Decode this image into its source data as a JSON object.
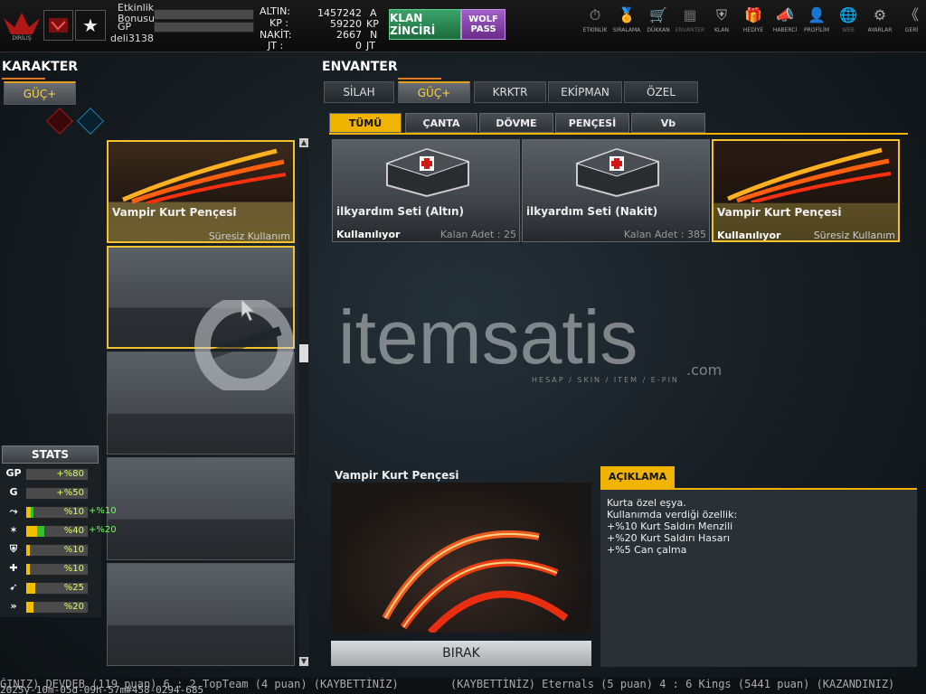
{
  "player": {
    "event_bonus_label": "Etkinlik Bonusu",
    "gp_label": "GP",
    "username": "deli3138"
  },
  "currency": [
    {
      "label": "ALTIN:",
      "value": "1457242",
      "unit": "A"
    },
    {
      "label": "KP :",
      "value": "59220",
      "unit": "KP"
    },
    {
      "label": "NAKİT:",
      "value": "2667",
      "unit": "N"
    },
    {
      "label": "JT :",
      "value": "0",
      "unit": "JT"
    }
  ],
  "buttons": {
    "klan": "KLAN ZİNCİRİ",
    "wolf": "WOLF PASS",
    "drop": "BIRAK"
  },
  "nav": [
    {
      "label": "ETKİNLİK",
      "icon": "stopwatch-icon",
      "glyph": "⏱"
    },
    {
      "label": "SIRALAMA",
      "icon": "medal-icon",
      "glyph": "🏅"
    },
    {
      "label": "DÜKKAN",
      "icon": "cart-icon",
      "glyph": "🛒"
    },
    {
      "label": "ENVANTER",
      "icon": "inventory-icon",
      "glyph": "▦"
    },
    {
      "label": "KLAN",
      "icon": "shield-icon",
      "glyph": "⛨"
    },
    {
      "label": "HEDİYE",
      "icon": "gift-icon",
      "glyph": "🎁"
    },
    {
      "label": "HABERCİ",
      "icon": "megaphone-icon",
      "glyph": "📣"
    },
    {
      "label": "PROFİLİM",
      "icon": "profile-icon",
      "glyph": "👤"
    },
    {
      "label": "WEB",
      "icon": "globe-icon",
      "glyph": "🌐"
    },
    {
      "label": "AYARLAR",
      "icon": "gear-icon",
      "glyph": "⚙"
    },
    {
      "label": "GERİ",
      "icon": "back-icon",
      "glyph": "《"
    }
  ],
  "character": {
    "title": "KARAKTER",
    "tab": "GÜÇ+"
  },
  "inventory": {
    "title": "ENVANTER",
    "tabs": [
      "SİLAH",
      "GÜÇ+",
      "KRKTR",
      "EKİPMAN",
      "ÖZEL"
    ],
    "subtabs": [
      "TÜMÜ",
      "ÇANTA",
      "DÖVME",
      "PENÇESİ",
      "Vb"
    ]
  },
  "slots": [
    {
      "name": "Vampir Kurt Pençesi",
      "duration": "Süresiz Kullanım"
    }
  ],
  "items": [
    {
      "name": "ilkyardım Seti (Altın)",
      "status": "Kullanılıyor",
      "info": "Kalan Adet : 25"
    },
    {
      "name": "ilkyardım Seti (Nakit)",
      "status": "",
      "info": "Kalan Adet : 385"
    },
    {
      "name": "Vampir Kurt Pençesi",
      "status": "Kullanılıyor",
      "info": "Süresiz Kullanım"
    }
  ],
  "stats": {
    "title": "STATS",
    "rows": [
      {
        "icon": "gp-icon",
        "glyph": "GP",
        "value": "+%80",
        "bonus": "",
        "fill": 0
      },
      {
        "icon": "g-icon",
        "glyph": "G",
        "value": "+%50",
        "bonus": "",
        "fill": 0
      },
      {
        "icon": "boot-icon",
        "glyph": "⤳",
        "value": "%10",
        "bonus": "+%10",
        "fill": 0.12
      },
      {
        "icon": "claw-icon",
        "glyph": "✶",
        "value": "%40",
        "bonus": "+%20",
        "fill": 0.3
      },
      {
        "icon": "shield-icon",
        "glyph": "⛨",
        "value": "%10",
        "bonus": "",
        "fill": 0.06
      },
      {
        "icon": "health-icon",
        "glyph": "✚",
        "value": "%10",
        "bonus": "",
        "fill": 0.06
      },
      {
        "icon": "speed-icon",
        "glyph": "➹",
        "value": "%25",
        "bonus": "",
        "fill": 0.14
      },
      {
        "icon": "dash-icon",
        "glyph": "»",
        "value": "%20",
        "bonus": "",
        "fill": 0.12
      }
    ]
  },
  "preview": {
    "name": "Vampir Kurt Pençesi"
  },
  "description": {
    "title": "AÇIKLAMA",
    "lines": [
      "Kurta özel eşya.",
      "Kullanımda verdiği özellik:",
      "+%10 Kurt Saldırı Menzili",
      "+%20 Kurt Saldırı Hasarı",
      "+%5 Can çalma"
    ]
  },
  "ticker": {
    "line1_left": "ĞINIZ) DEVDEB (119 puan) 6 : 2 TopTeam (4 puan) (KAYBETTİNİZ)",
    "line1_right": "(KAYBETTİNİZ) Eternals (5 puan) 4 : 6 Kings (5441 puan) (KAZANDINIZ)",
    "line2": "2025y-10m-05d-09h-57m#458-0294-685"
  },
  "watermark": {
    "brand": "itemsatis",
    "suffix": ".com",
    "tagline": "HESAP / SKIN / ITEM / E-PIN"
  }
}
